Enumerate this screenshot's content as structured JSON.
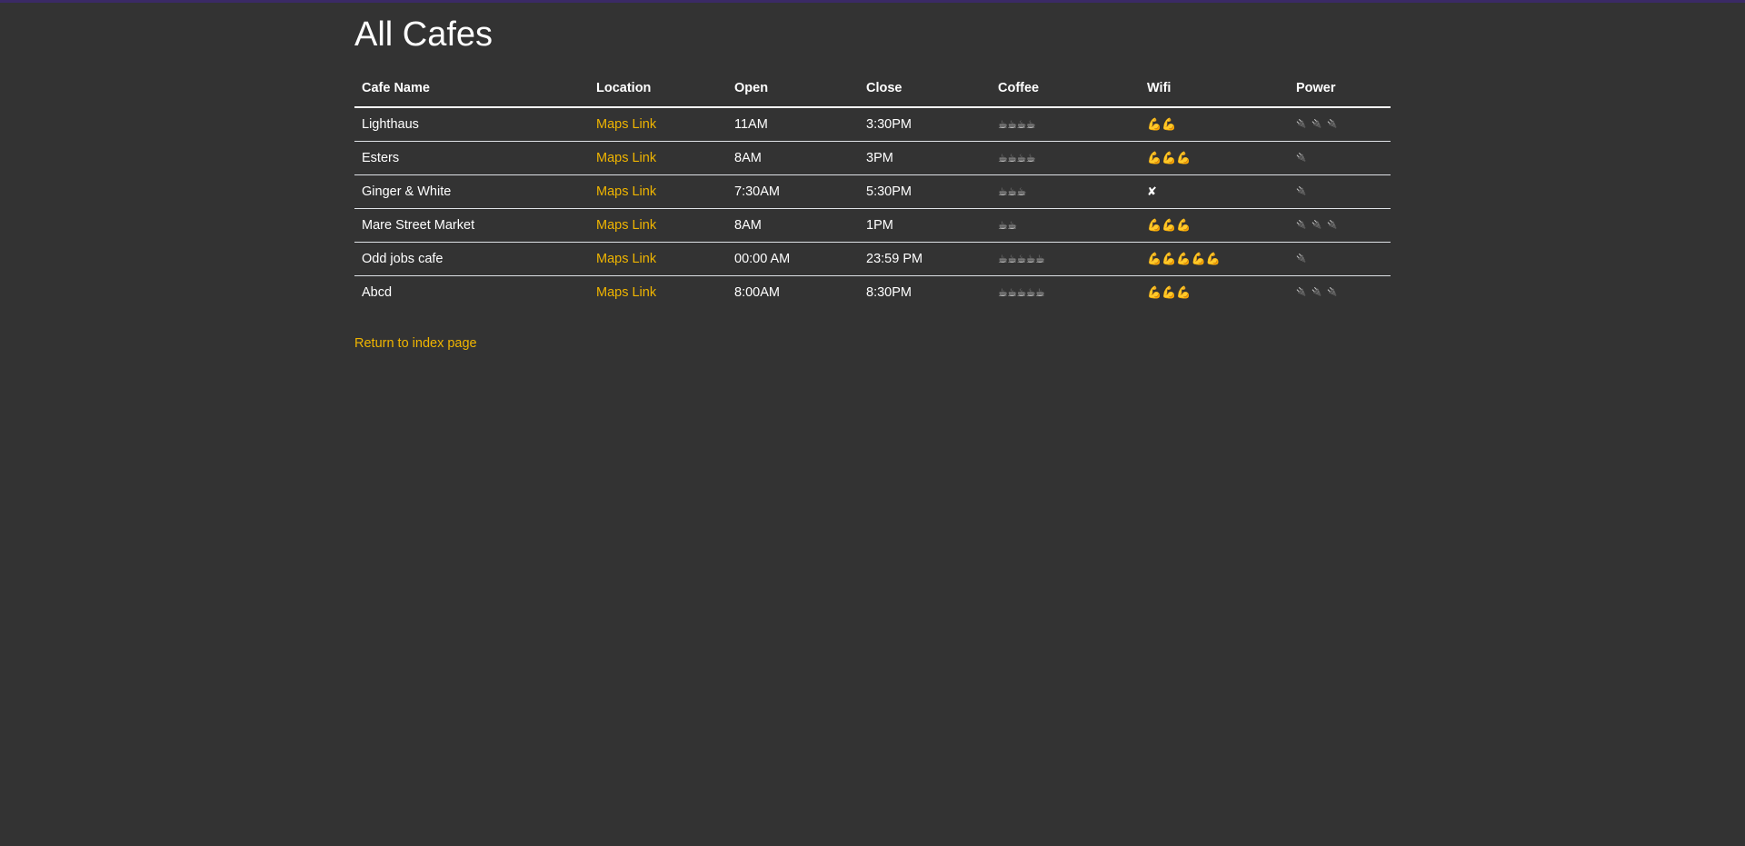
{
  "page": {
    "title": "All Cafes",
    "return_link": "Return to index page"
  },
  "table": {
    "headers": [
      "Cafe Name",
      "Location",
      "Open",
      "Close",
      "Coffee",
      "Wifi",
      "Power"
    ],
    "rows": [
      {
        "name": "Lighthaus",
        "location": "Maps Link",
        "open": "11AM",
        "close": "3:30PM",
        "coffee": "☕☕☕☕",
        "wifi": "💪💪",
        "power": "🔌🔌🔌"
      },
      {
        "name": "Esters",
        "location": "Maps Link",
        "open": "8AM",
        "close": "3PM",
        "coffee": "☕☕☕☕",
        "wifi": "💪💪💪",
        "power": "🔌"
      },
      {
        "name": "Ginger & White",
        "location": "Maps Link",
        "open": "7:30AM",
        "close": "5:30PM",
        "coffee": "☕☕☕",
        "wifi": "✘",
        "power": "🔌"
      },
      {
        "name": "Mare Street Market",
        "location": "Maps Link",
        "open": "8AM",
        "close": "1PM",
        "coffee": "☕☕",
        "wifi": "💪💪💪",
        "power": "🔌🔌🔌"
      },
      {
        "name": "Odd jobs cafe",
        "location": "Maps Link",
        "open": "00:00 AM",
        "close": "23:59 PM",
        "coffee": "☕☕☕☕☕",
        "wifi": "💪💪💪💪💪",
        "power": "🔌"
      },
      {
        "name": "Abcd",
        "location": "Maps Link",
        "open": "8:00AM",
        "close": "8:30PM",
        "coffee": "☕☕☕☕☕",
        "wifi": "💪💪💪",
        "power": "🔌🔌🔌"
      }
    ]
  },
  "colors": {
    "background": "#333333",
    "link": "#f0b500",
    "text": "#ffffff",
    "top_accent": "#3b2a66"
  }
}
